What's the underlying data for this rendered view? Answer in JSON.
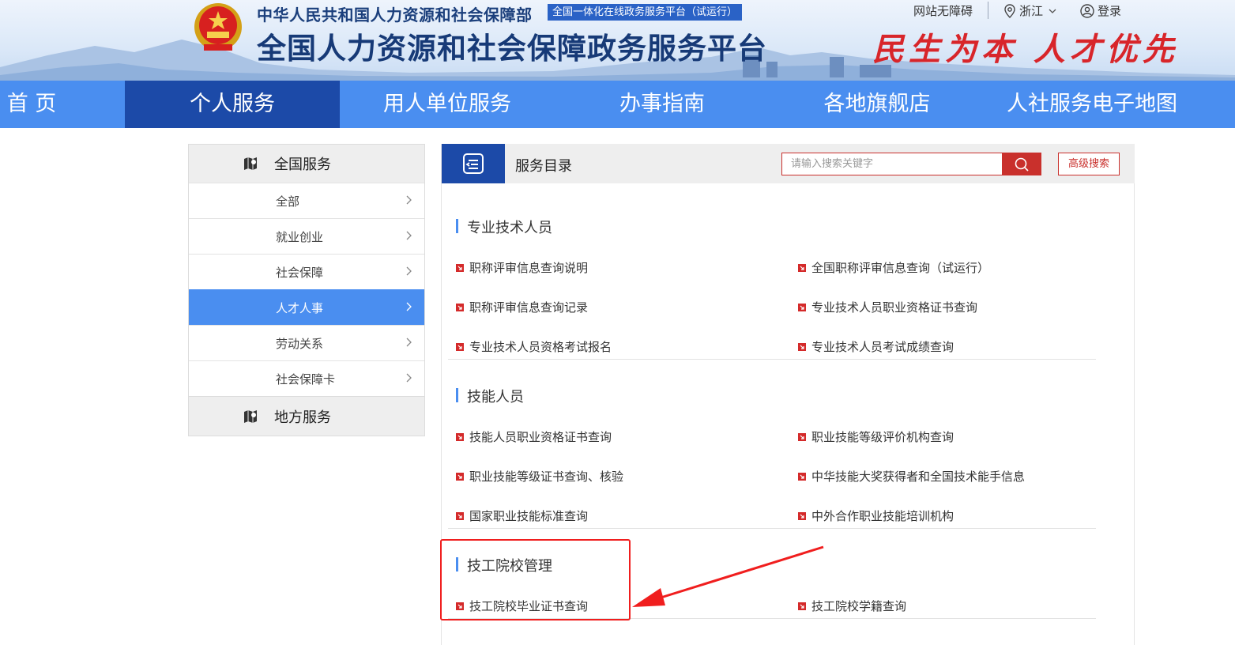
{
  "header": {
    "ministry": "中华人民共和国人力资源和社会保障部",
    "badge": "全国一体化在线政务服务平台（试运行）",
    "platform_title": "全国人力资源和社会保障政务服务平台",
    "slogan": "民生为本 人才优先",
    "accessibility": "网站无障碍",
    "region": "浙江",
    "login": "登录",
    "icons": [
      "national-emblem-icon",
      "location-pin-icon",
      "chevron-down-icon",
      "user-circle-icon"
    ]
  },
  "nav": [
    {
      "label": "首 页",
      "active": false
    },
    {
      "label": "个人服务",
      "active": true
    },
    {
      "label": "用人单位服务",
      "active": false
    },
    {
      "label": "办事指南",
      "active": false
    },
    {
      "label": "各地旗舰店",
      "active": false
    },
    {
      "label": "人社服务电子地图",
      "active": false
    }
  ],
  "sidebar": {
    "national": "全国服务",
    "items": [
      {
        "label": "全部",
        "active": false
      },
      {
        "label": "就业创业",
        "active": false
      },
      {
        "label": "社会保障",
        "active": false
      },
      {
        "label": "人才人事",
        "active": true
      },
      {
        "label": "劳动关系",
        "active": false
      },
      {
        "label": "社会保障卡",
        "active": false
      }
    ],
    "local": "地方服务"
  },
  "catalog": {
    "title": "服务目录",
    "search_placeholder": "请输入搜索关键字",
    "advanced_search": "高级搜索"
  },
  "sections": [
    {
      "title": "专业技术人员",
      "items": [
        "职称评审信息查询说明",
        "全国职称评审信息查询（试运行）",
        "职称评审信息查询记录",
        "专业技术人员职业资格证书查询",
        "专业技术人员资格考试报名",
        "专业技术人员考试成绩查询"
      ]
    },
    {
      "title": "技能人员",
      "items": [
        "技能人员职业资格证书查询",
        "职业技能等级评价机构查询",
        "职业技能等级证书查询、核验",
        "中华技能大奖获得者和全国技术能手信息",
        "国家职业技能标准查询",
        "中外合作职业技能培训机构"
      ]
    },
    {
      "title": "技工院校管理",
      "items": [
        "技工院校毕业证书查询",
        "技工院校学籍查询"
      ]
    }
  ],
  "colors": {
    "nav_bg": "#4a8ef0",
    "nav_active": "#1c4aa8",
    "accent_red": "#c9302c",
    "annotation_red": "#f01e1e"
  }
}
